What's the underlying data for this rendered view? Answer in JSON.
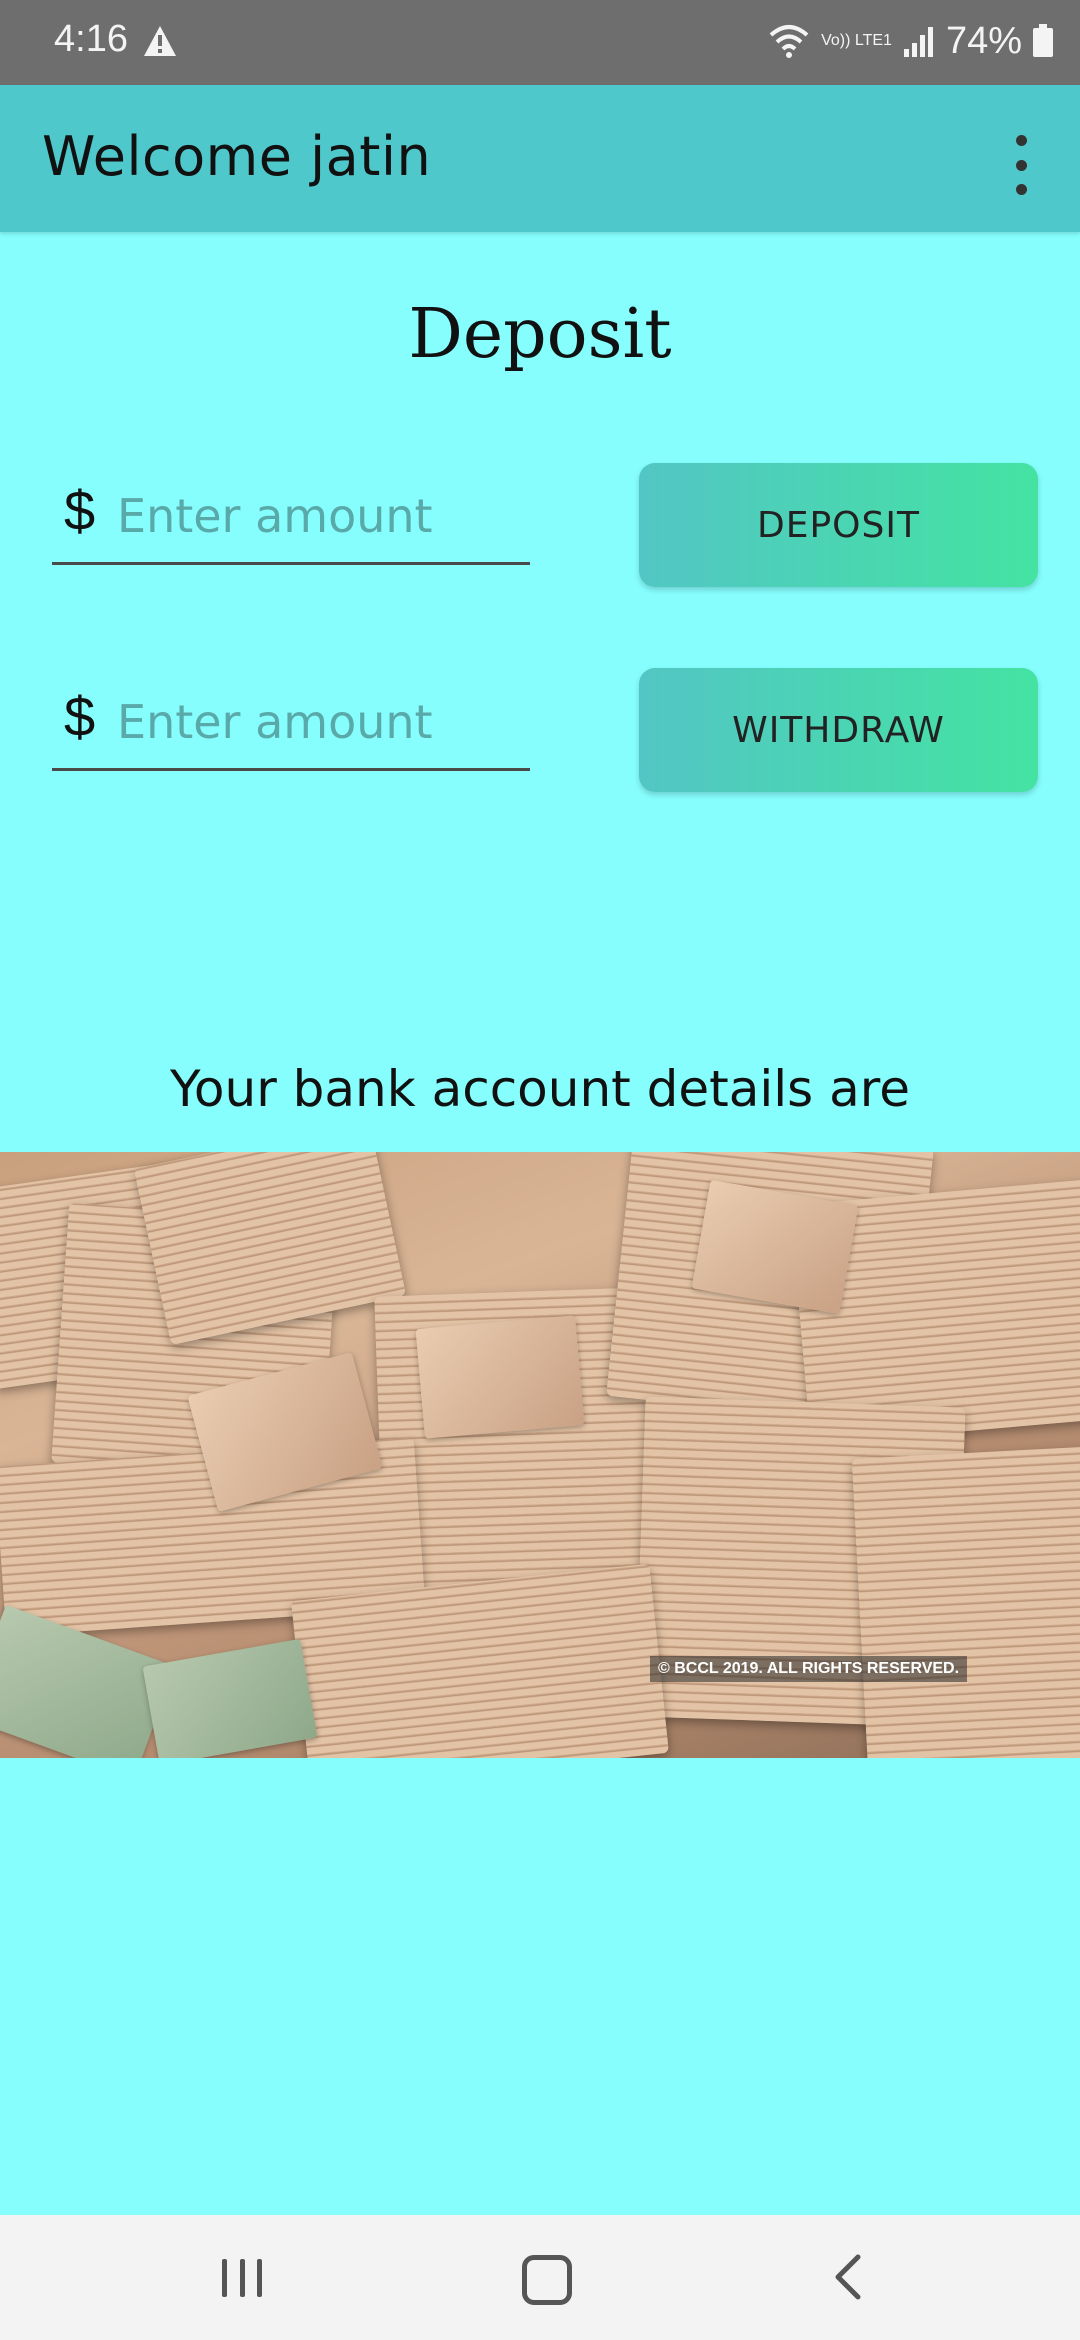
{
  "status_bar": {
    "time": "4:16",
    "battery": "74%",
    "network_label": "Vo)) LTE1"
  },
  "app_bar": {
    "title": "Welcome jatin",
    "overflow_icon": "more-vert-icon"
  },
  "main": {
    "heading": "Deposit",
    "deposit": {
      "currency_symbol": "$",
      "placeholder": "Enter amount",
      "value": "",
      "button_label": "DEPOSIT"
    },
    "withdraw": {
      "currency_symbol": "$",
      "placeholder": "Enter amount",
      "value": "",
      "button_label": "WITHDRAW"
    },
    "details_label": "Your bank account details are",
    "photo": {
      "subject": "stacks of rupee banknotes",
      "caption": "© BCCL 2019. ALL RIGHTS RESERVED."
    }
  },
  "nav_bar": {
    "recents_icon": "recents-icon",
    "home_icon": "home-icon",
    "back_icon": "back-icon"
  },
  "colors": {
    "background": "#86FEFE",
    "app_bar": "#4FC8CB",
    "button_gradient_start": "#52C6C4",
    "button_gradient_end": "#44E3A2"
  }
}
